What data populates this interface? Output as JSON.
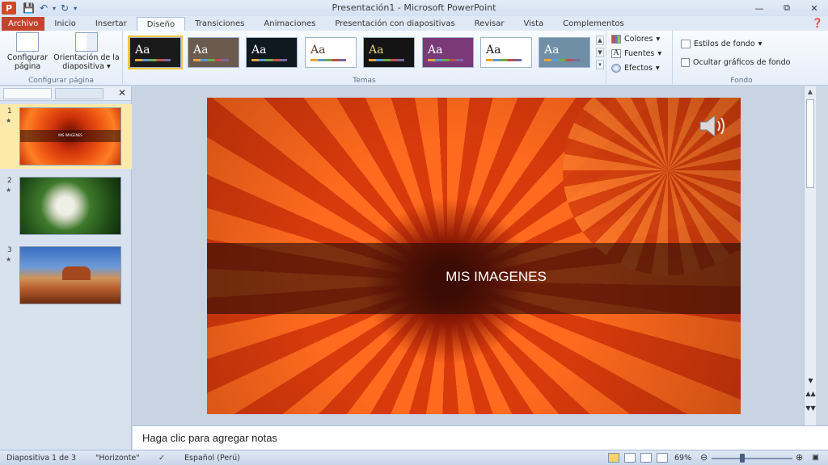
{
  "window": {
    "title": "Presentación1 - Microsoft PowerPoint",
    "app_logo": "P"
  },
  "tabs": [
    {
      "label": "Archivo"
    },
    {
      "label": "Inicio"
    },
    {
      "label": "Insertar"
    },
    {
      "label": "Diseño"
    },
    {
      "label": "Transiciones"
    },
    {
      "label": "Animaciones"
    },
    {
      "label": "Presentación con diapositivas"
    },
    {
      "label": "Revisar"
    },
    {
      "label": "Vista"
    },
    {
      "label": "Complementos"
    }
  ],
  "ribbon": {
    "page_setup": {
      "configurar_label": "Configurar página",
      "orientacion_label": "Orientación de la diapositiva",
      "group_label": "Configurar página"
    },
    "themes": {
      "group_label": "Temas",
      "items": [
        {
          "label": "Aa",
          "bg": "#1a1a1a",
          "fg": "#ffffff"
        },
        {
          "label": "Aa",
          "bg": "#6b5a4e",
          "fg": "#ffffff"
        },
        {
          "label": "Aa",
          "bg": "#101820",
          "fg": "#ffffff"
        },
        {
          "label": "Aa",
          "bg": "#ffffff",
          "fg": "#5a3b2a"
        },
        {
          "label": "Aa",
          "bg": "#141414",
          "fg": "#e8d27a"
        },
        {
          "label": "Aa",
          "bg": "#7a3a78",
          "fg": "#ffffff"
        },
        {
          "label": "Aa",
          "bg": "#ffffff",
          "fg": "#1a1a1a"
        },
        {
          "label": "Aa",
          "bg": "#6e8fa6",
          "fg": "#ffffff"
        }
      ],
      "colores_label": "Colores",
      "fuentes_label": "Fuentes",
      "efectos_label": "Efectos"
    },
    "background": {
      "estilos_label": "Estilos de fondo",
      "ocultar_label": "Ocultar gráficos de fondo",
      "group_label": "Fondo"
    }
  },
  "slides": [
    {
      "number": "1",
      "thumb_text": "MIS IMAGENES"
    },
    {
      "number": "2"
    },
    {
      "number": "3"
    }
  ],
  "slide": {
    "title": "MIS IMAGENES"
  },
  "notes": {
    "placeholder": "Haga clic para agregar notas"
  },
  "status": {
    "slide_info": "Diapositiva 1 de 3",
    "theme": "\"Horizonte\"",
    "language": "Español (Perú)",
    "zoom": "69%",
    "zoom_fraction": 0.38
  },
  "colors": {
    "file_tab": "#c4432d",
    "accent": "#2b579a"
  }
}
